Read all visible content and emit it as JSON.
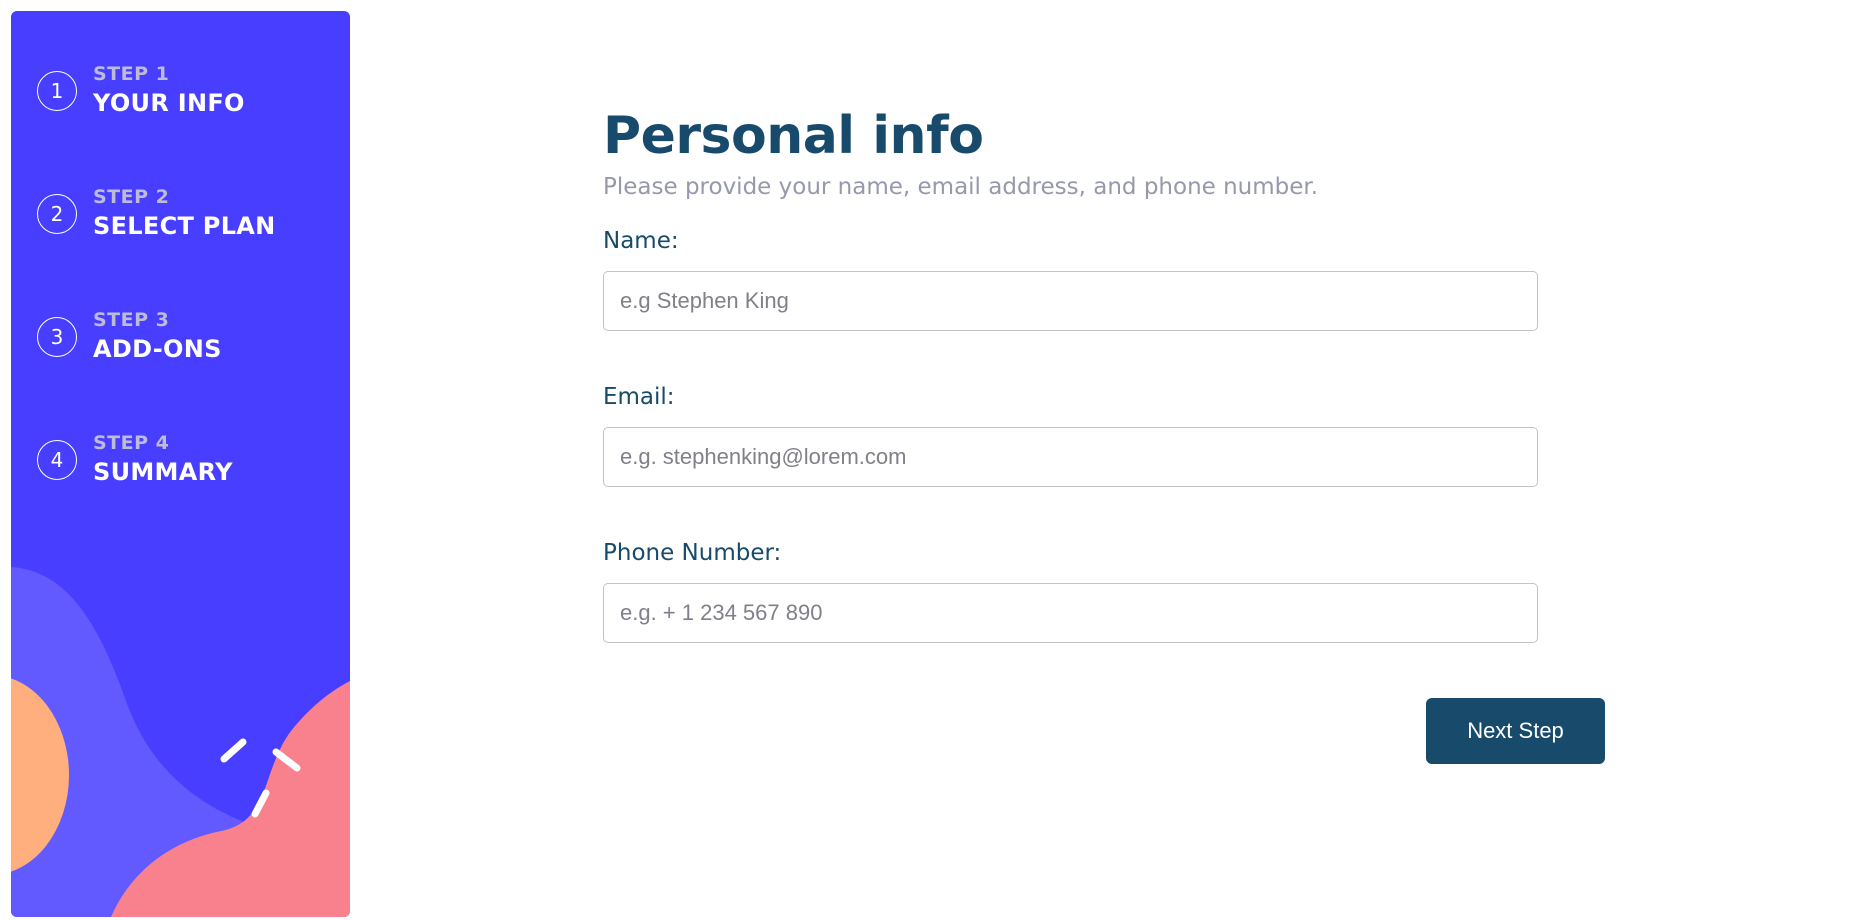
{
  "sidebar": {
    "steps": [
      {
        "number": "1",
        "label": "STEP 1",
        "title": "YOUR INFO"
      },
      {
        "number": "2",
        "label": "STEP 2",
        "title": "SELECT PLAN"
      },
      {
        "number": "3",
        "label": "STEP 3",
        "title": "ADD-ONS"
      },
      {
        "number": "4",
        "label": "STEP 4",
        "title": "SUMMARY"
      }
    ],
    "colors": {
      "background": "#483eff",
      "wave_purple": "#6259ff",
      "wave_pink": "#f9818e",
      "circle_orange": "#ffaf7e"
    }
  },
  "main": {
    "title": "Personal info",
    "subtitle": "Please provide your name, email address, and phone number.",
    "fields": {
      "name": {
        "label": "Name:",
        "placeholder": "e.g Stephen King",
        "value": ""
      },
      "email": {
        "label": "Email:",
        "placeholder": "e.g. stephenking@lorem.com",
        "value": ""
      },
      "phone": {
        "label": "Phone Number:",
        "placeholder": "e.g. + 1 234 567 890",
        "value": ""
      }
    },
    "next_button": "Next Step"
  },
  "colors": {
    "primary": "#174a6b",
    "muted_text": "#9699ab",
    "border": "#c2c2c7"
  }
}
